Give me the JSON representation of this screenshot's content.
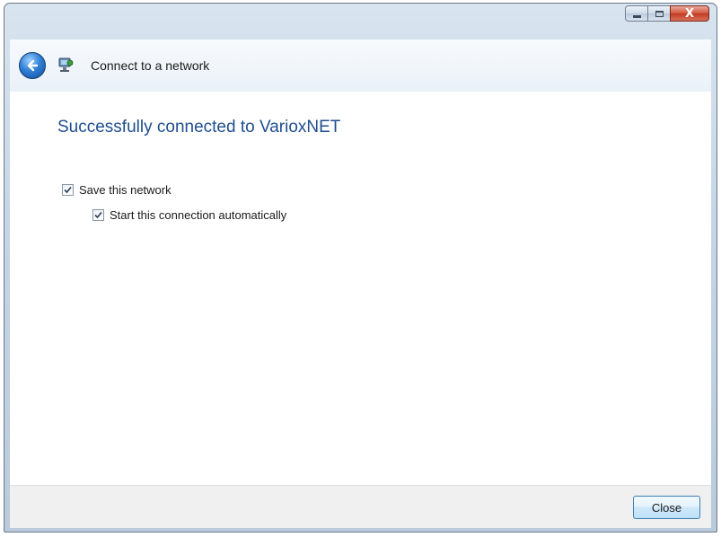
{
  "window": {
    "caption_buttons": {
      "minimize_icon": "minimize-icon",
      "maximize_icon": "maximize-icon",
      "close_glyph": "X"
    }
  },
  "header": {
    "back_icon": "back-arrow-icon",
    "app_icon": "network-icon",
    "title": "Connect to a network"
  },
  "main": {
    "heading": "Successfully connected to VarioxNET",
    "options": [
      {
        "label": "Save this network",
        "checked": true
      },
      {
        "label": "Start this connection automatically",
        "checked": true
      }
    ]
  },
  "footer": {
    "close_label": "Close"
  },
  "colors": {
    "heading": "#1f4f8f",
    "footer_bg": "#f0f0f0",
    "close_button_border": "#3c7fb1"
  }
}
